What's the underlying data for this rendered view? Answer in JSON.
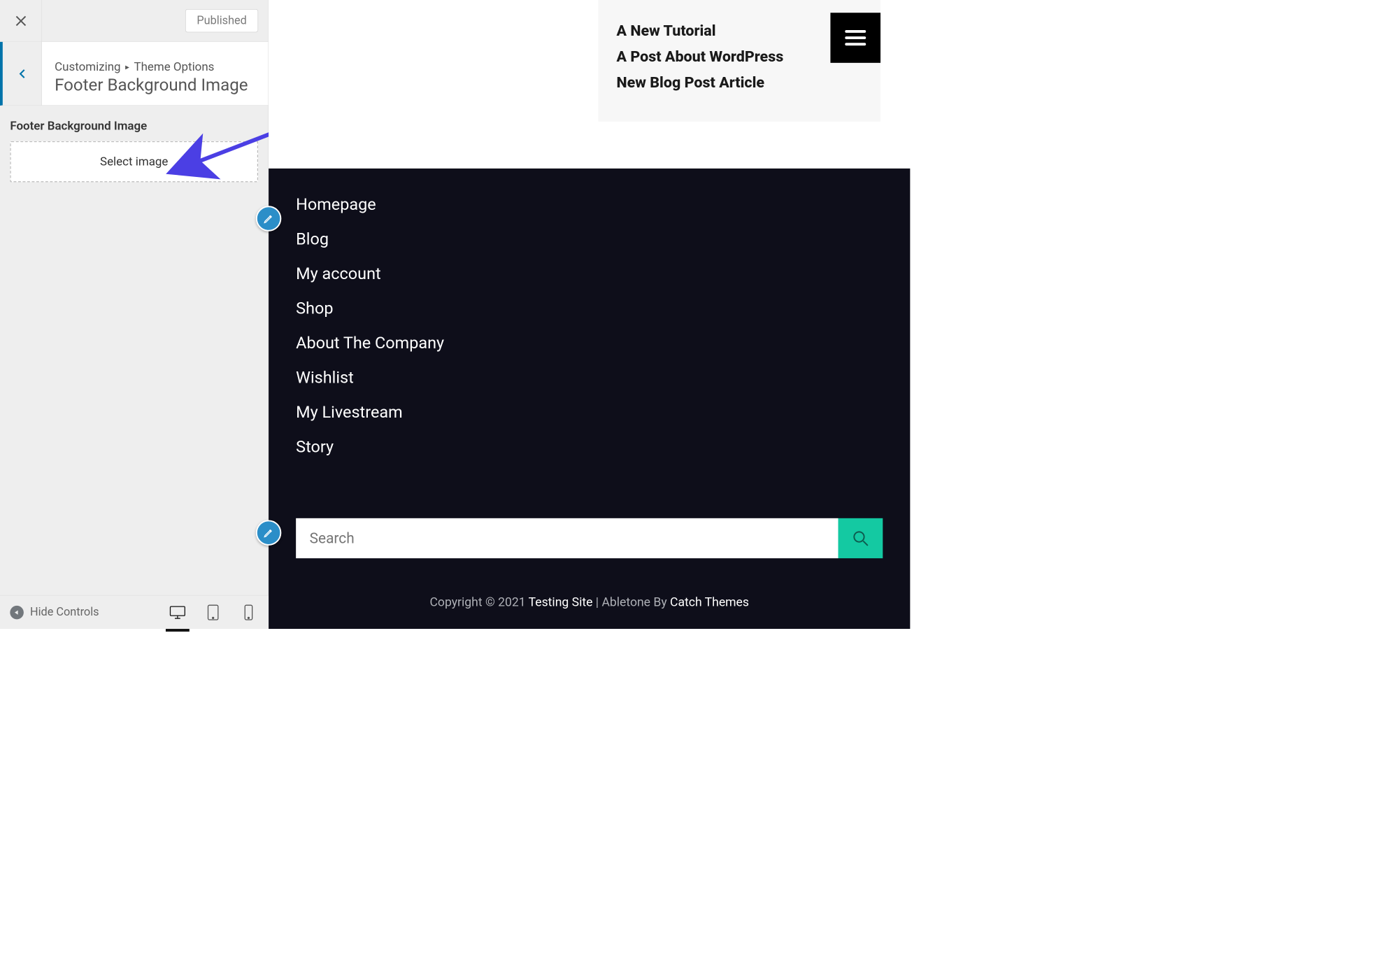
{
  "sidebar": {
    "publish_label": "Published",
    "breadcrumb_prefix": "Customizing",
    "breadcrumb_section": "Theme Options",
    "breadcrumb_title": "Footer Background Image",
    "field_label": "Footer Background Image",
    "select_image_label": "Select image"
  },
  "bottom": {
    "hide_controls_label": "Hide Controls"
  },
  "preview": {
    "posts": [
      "A New Tutorial",
      "A Post About WordPress",
      "New Blog Post Article"
    ],
    "footer_menu": [
      "Homepage",
      "Blog",
      "My account",
      "Shop",
      "About The Company",
      "Wishlist",
      "My Livestream",
      "Story"
    ],
    "search_placeholder": "Search",
    "copyright": {
      "prefix": "Copyright © 2021 ",
      "site": "Testing Site",
      "middle": " | Abletone By ",
      "author": "Catch Themes"
    }
  }
}
